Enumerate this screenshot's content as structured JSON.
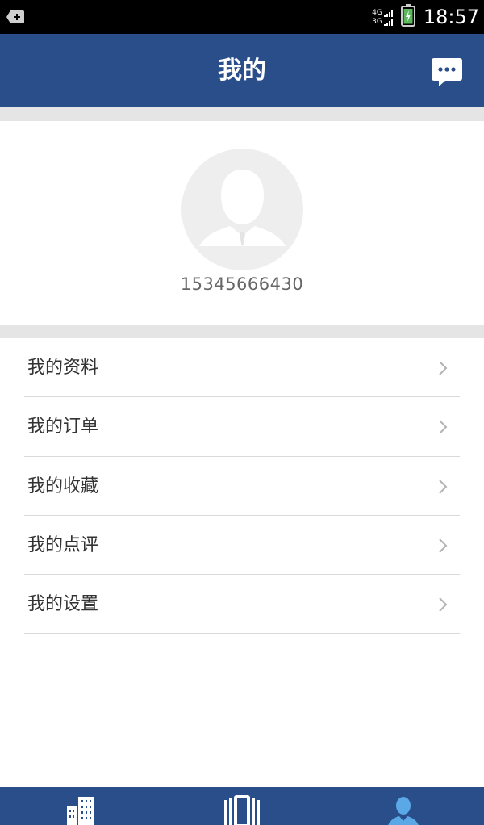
{
  "status_bar": {
    "time": "18:57",
    "network_top": "4G",
    "network_bottom": "3G"
  },
  "header": {
    "title": "我的",
    "chat_icon": "chat-bubble-icon"
  },
  "profile": {
    "avatar_icon": "default-avatar-icon",
    "phone": "15345666430"
  },
  "menu": {
    "items": [
      {
        "label": "我的资料"
      },
      {
        "label": "我的订单"
      },
      {
        "label": "我的收藏"
      },
      {
        "label": "我的点评"
      },
      {
        "label": "我的设置"
      }
    ]
  },
  "tab_bar": {
    "tabs": [
      {
        "icon": "buildings-icon",
        "active": false
      },
      {
        "icon": "cards-icon",
        "active": false
      },
      {
        "icon": "user-icon",
        "active": true
      }
    ],
    "colors": {
      "background": "#2a4e8a",
      "active_icon": "#5aa8e6",
      "icon": "#ffffff"
    }
  },
  "colors": {
    "header_bg": "#2a4e8a",
    "separator": "#e5e5e5",
    "text": "#333333",
    "phone_text": "#666666"
  }
}
